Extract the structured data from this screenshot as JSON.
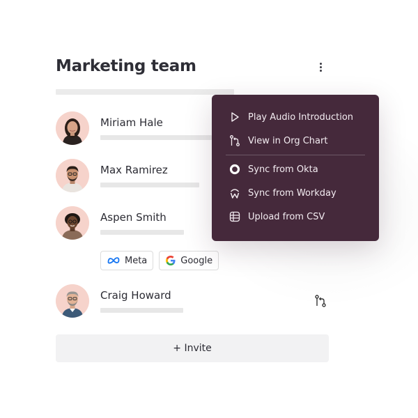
{
  "team": {
    "title": "Marketing team",
    "more_icon": "vertical-ellipsis-icon"
  },
  "members": [
    {
      "name": "Miriam Hale",
      "avatar": "avatar-miriam-hale"
    },
    {
      "name": "Max Ramirez",
      "avatar": "avatar-max-ramirez"
    },
    {
      "name": "Aspen Smith",
      "avatar": "avatar-aspen-smith"
    },
    {
      "name": "Craig Howard",
      "avatar": "avatar-craig-howard"
    }
  ],
  "chips": [
    {
      "label": "Meta",
      "icon": "meta-logo-icon"
    },
    {
      "label": "Google",
      "icon": "google-logo-icon"
    }
  ],
  "invite": {
    "label": "+ Invite"
  },
  "menu": {
    "items": [
      {
        "label": "Play Audio Introduction",
        "icon": "play-icon"
      },
      {
        "label": "View in Org Chart",
        "icon": "org-chart-icon"
      },
      {
        "label": "Sync from Okta",
        "icon": "okta-icon"
      },
      {
        "label": "Sync from Workday",
        "icon": "workday-icon"
      },
      {
        "label": "Upload from CSV",
        "icon": "csv-table-icon"
      }
    ]
  },
  "colors": {
    "menu_background": "#45293b",
    "avatar_background": "#f6d3cb",
    "placeholder_bar": "#e7e7e7",
    "invite_background": "#f2f2f3"
  }
}
